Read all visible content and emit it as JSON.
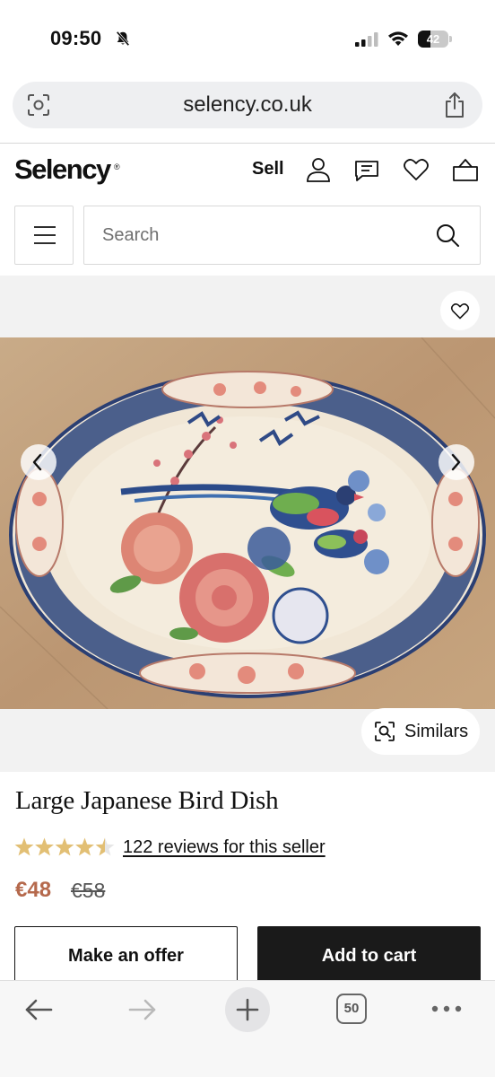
{
  "status_bar": {
    "time": "09:50",
    "battery_level": "42",
    "battery_fraction": 0.42,
    "icons": [
      "bell-slash-icon",
      "signal-icon",
      "wifi-icon",
      "battery-icon"
    ]
  },
  "browser": {
    "url": "selency.co.uk",
    "icons": [
      "lens-icon",
      "share-icon"
    ],
    "toolbar": {
      "tabs_count": "50",
      "icons": [
        "back-arrow-icon",
        "forward-arrow-icon",
        "plus-icon",
        "tabs-icon",
        "more-icon"
      ]
    }
  },
  "header": {
    "logo": "Selency",
    "logo_mark": "®",
    "sell_label": "Sell",
    "icons": [
      "user-icon",
      "chat-icon",
      "heart-icon",
      "bag-icon"
    ]
  },
  "search": {
    "placeholder": "Search",
    "value": ""
  },
  "gallery": {
    "similars_label": "Similars",
    "icons": [
      "heart-icon",
      "chevron-left-icon",
      "chevron-right-icon",
      "visual-search-icon"
    ]
  },
  "product": {
    "title": "Large Japanese Bird Dish",
    "rating": 4.5,
    "rating_max": 5,
    "reviews_label": "122 reviews for this seller",
    "price": "€48",
    "old_price": "€58",
    "make_offer_label": "Make an offer",
    "add_to_cart_label": "Add to cart"
  },
  "colors": {
    "price_accent": "#b5694c",
    "star": "#e2bf74",
    "button_dark": "#1a1a1a"
  }
}
